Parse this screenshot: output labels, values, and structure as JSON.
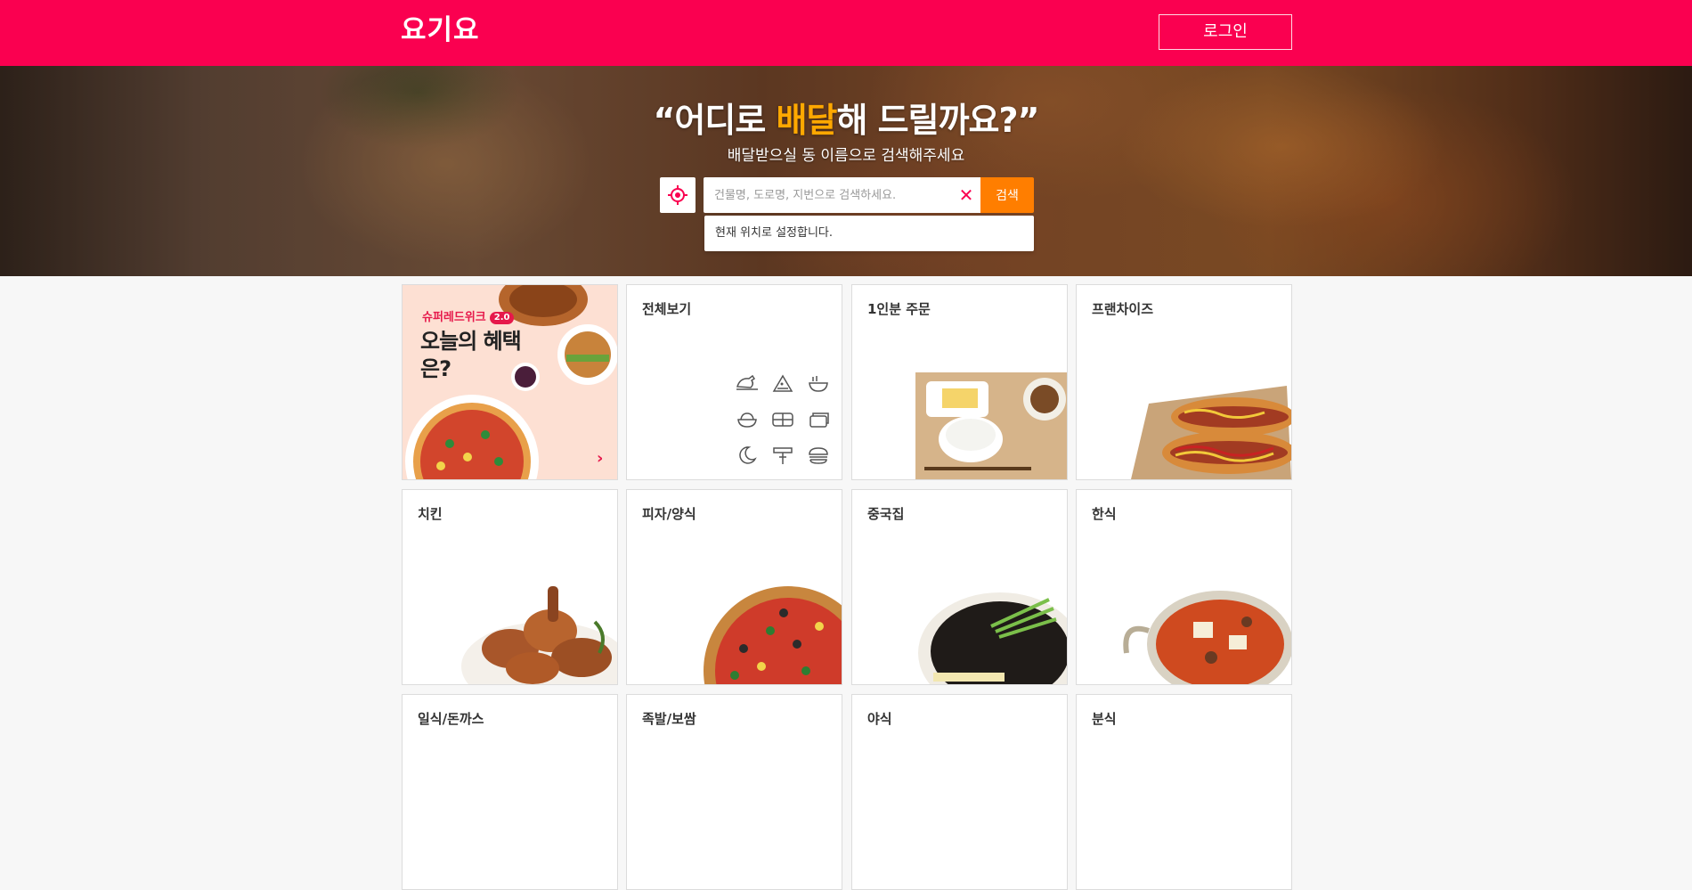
{
  "header": {
    "logo": "요기요",
    "login_label": "로그인",
    "brand_color": "#fa0050"
  },
  "hero": {
    "title_open": "“어디로 ",
    "title_highlight": "배달",
    "title_close": "해 드릴까요?”",
    "subtitle": "배달받으실 동 이름으로 검색해주세요",
    "location_icon": "crosshair-icon",
    "search_placeholder": "건물명, 도로명, 지번으로 검색하세요.",
    "search_value": "",
    "clear_icon": "close-icon",
    "search_button": "검색",
    "suggestion": "현재 위치로 설정합니다.",
    "highlight_color": "#ffa800",
    "search_button_color": "#ff7e00"
  },
  "promo": {
    "tag": "슈퍼레드위크",
    "badge": "2.0",
    "title": "오늘의 혜택은?",
    "arrow_icon": "chevron-right-icon"
  },
  "categories": [
    {
      "label": "전체보기",
      "icons": [
        "chicken-icon",
        "pizza-icon",
        "noodle-bowl-icon",
        "rice-bowl-icon",
        "bento-icon",
        "stacked-box-icon",
        "moon-icon",
        "skewer-icon",
        "burger-icon"
      ]
    },
    {
      "label": "1인분 주문"
    },
    {
      "label": "프랜차이즈"
    },
    {
      "label": "치킨"
    },
    {
      "label": "피자/양식"
    },
    {
      "label": "중국집"
    },
    {
      "label": "한식"
    },
    {
      "label": "일식/돈까스"
    },
    {
      "label": "족발/보쌈"
    },
    {
      "label": "야식"
    },
    {
      "label": "분식"
    }
  ]
}
